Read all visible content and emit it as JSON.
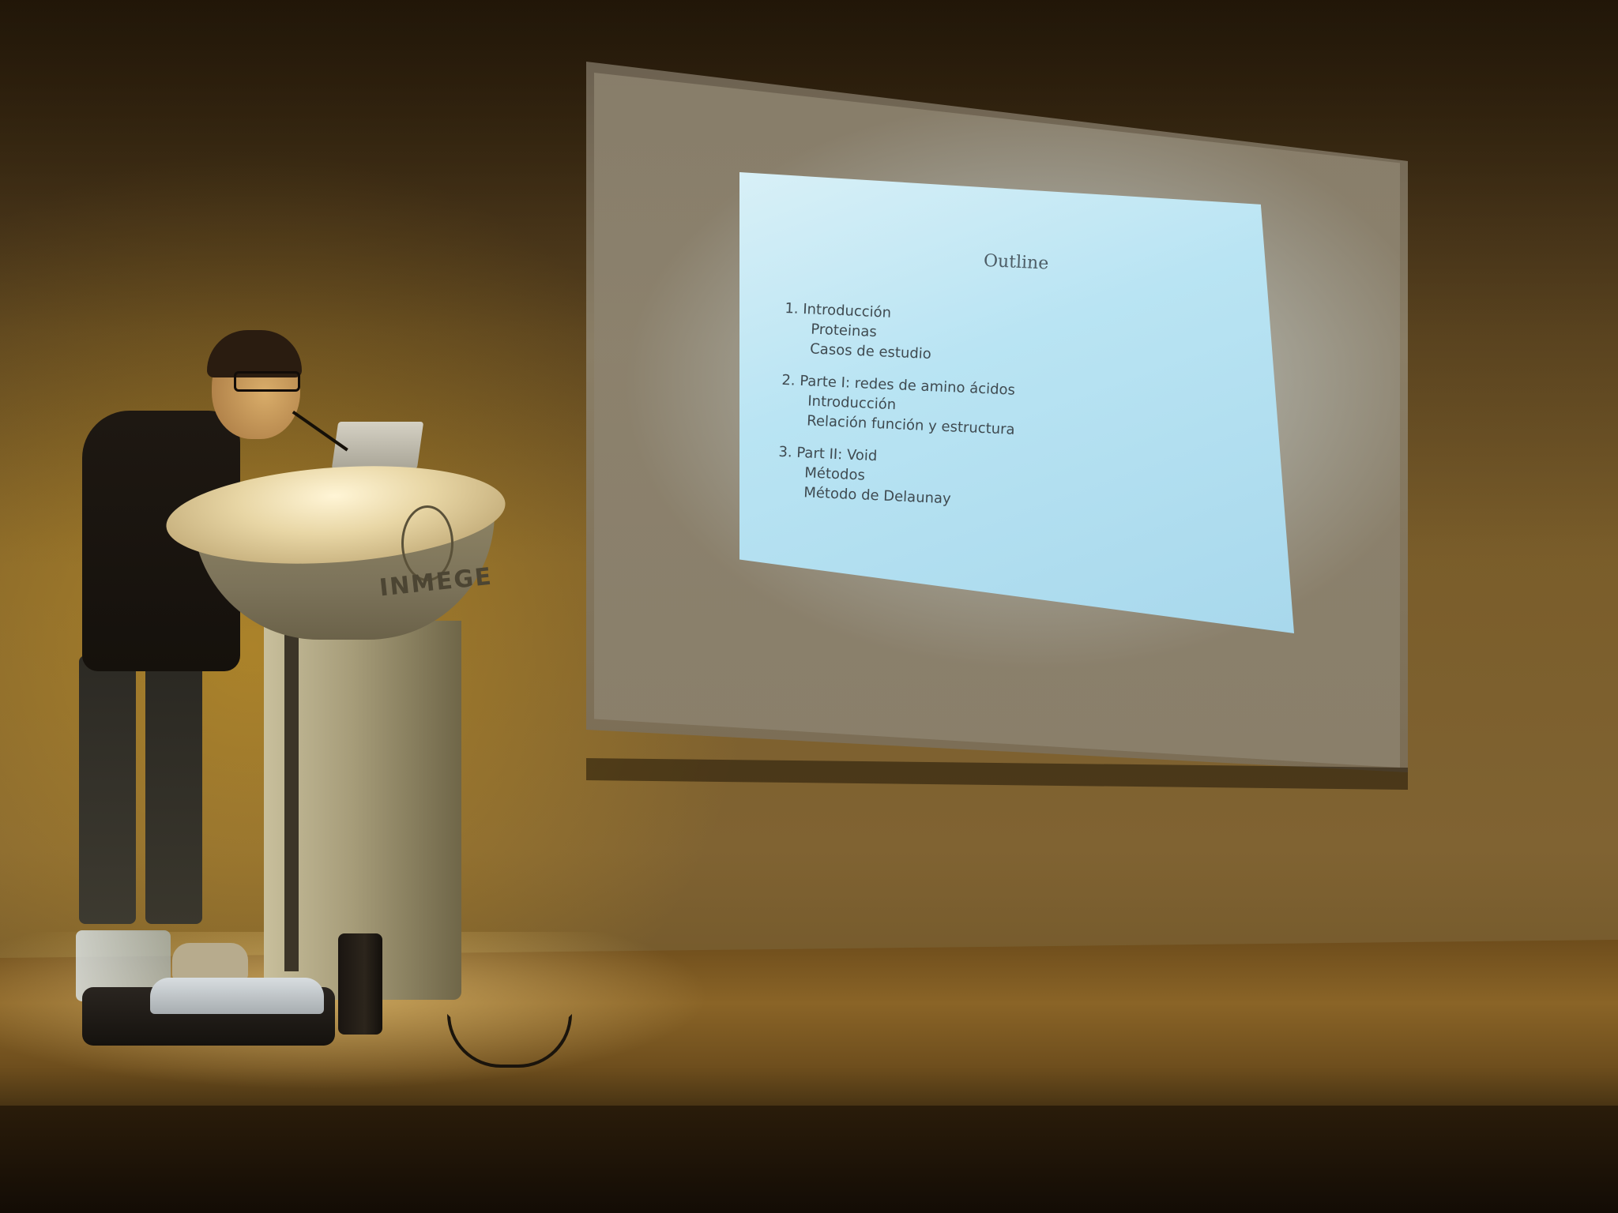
{
  "slide": {
    "title": "Outline",
    "sections": [
      {
        "heading": "1.  Introducción",
        "items": [
          "Proteinas",
          "Casos de estudio"
        ]
      },
      {
        "heading": "2.  Parte I: redes de amino ácidos",
        "items": [
          "Introducción",
          "Relación función y estructura"
        ]
      },
      {
        "heading": "3.  Part II: Void",
        "items": [
          "Métodos",
          "Método de Delaunay"
        ]
      }
    ]
  },
  "podium": {
    "logo_text": "INMEGE"
  },
  "colors": {
    "slide_background": "#b9e4f3",
    "slide_text": "#3f4a50",
    "stage_light": "#d2a028"
  }
}
